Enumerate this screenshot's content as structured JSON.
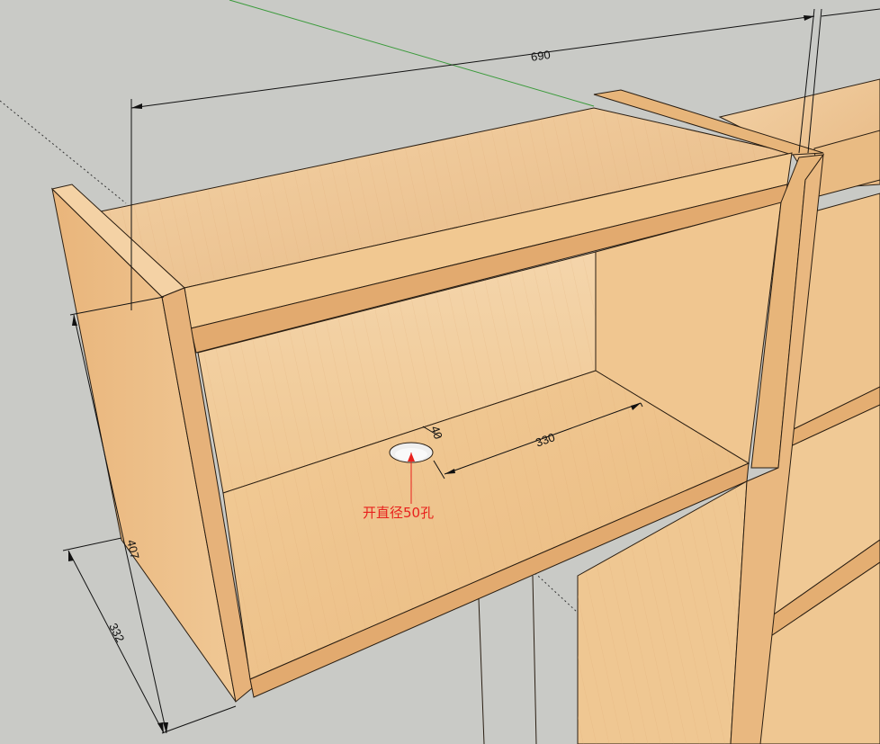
{
  "drawing": {
    "dimensions": {
      "width_top": "690",
      "height_side": "407",
      "depth_side": "332",
      "hole_offset": "40",
      "hole_to_side": "330"
    },
    "annotation": {
      "note": "开直径50孔"
    },
    "colors": {
      "background": "#c9cac6",
      "wood_light": "#f0c99a",
      "wood_mid": "#e8b97f",
      "wood_dark": "#d9a56c",
      "edge": "#2a1e12",
      "dimension_line": "#111111",
      "axis_green": "#3a9a3a",
      "note_red": "#e8211d"
    }
  }
}
